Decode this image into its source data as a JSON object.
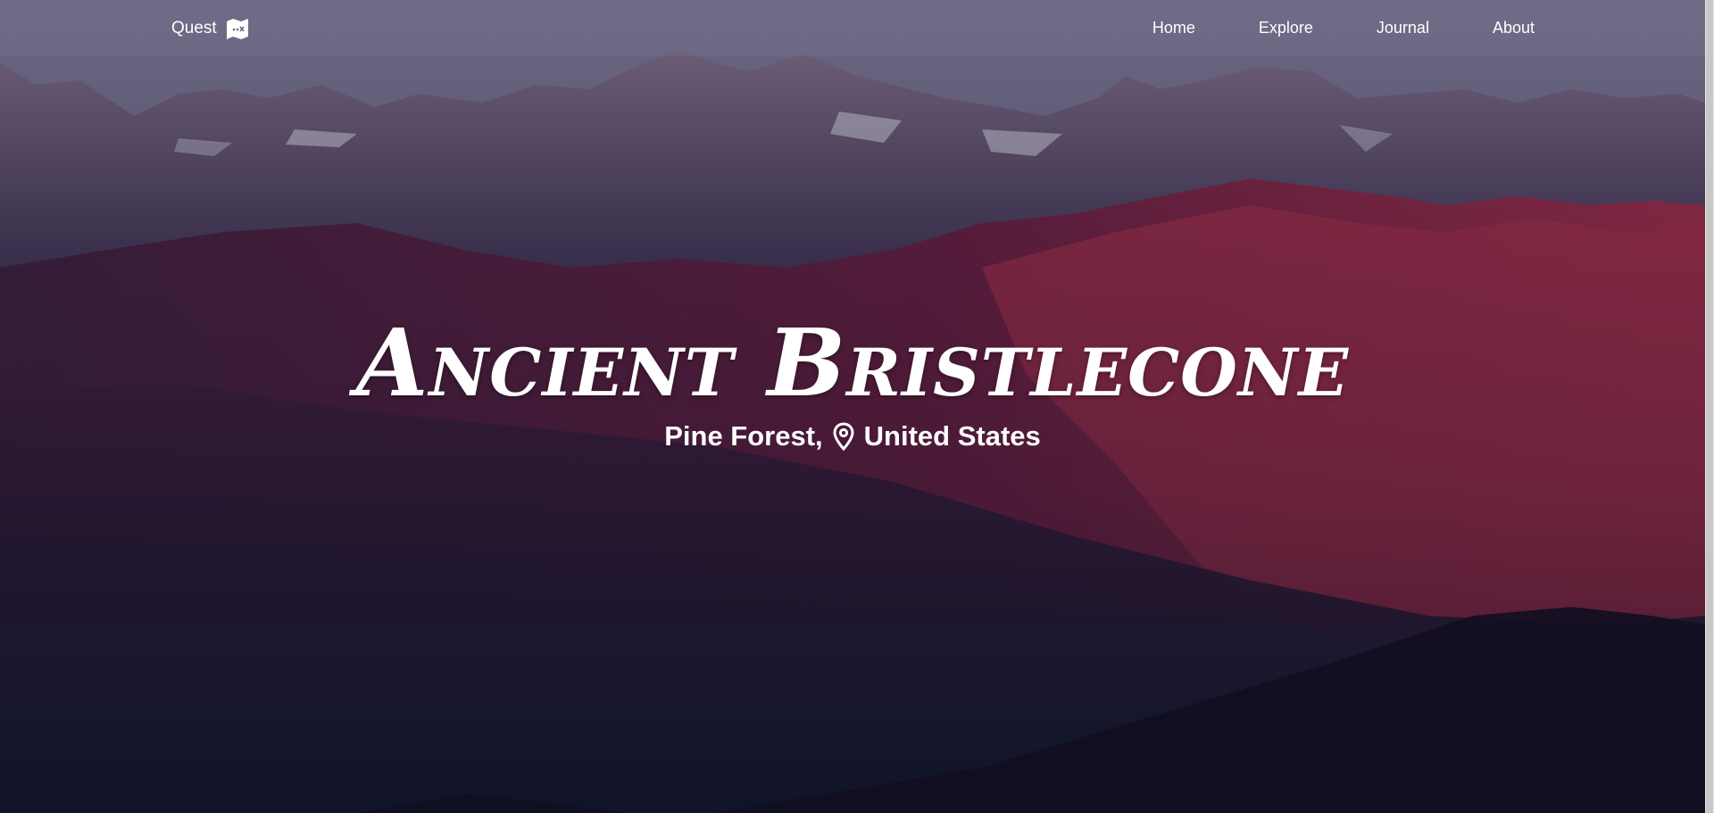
{
  "brand": {
    "name": "Quest",
    "icon": "map-icon"
  },
  "nav": {
    "items": [
      {
        "label": "Home"
      },
      {
        "label": "Explore"
      },
      {
        "label": "Journal"
      },
      {
        "label": "About"
      }
    ]
  },
  "hero": {
    "title": "Ancient Bristlecone",
    "subtitle_part1": "Pine Forest,",
    "location_icon": "map-pin-icon",
    "subtitle_part2": "United States"
  },
  "colors": {
    "sky": "#5a5670",
    "mountain_red": "#8a2a46",
    "mountain_dark": "#1a1830",
    "text": "#ffffff"
  }
}
